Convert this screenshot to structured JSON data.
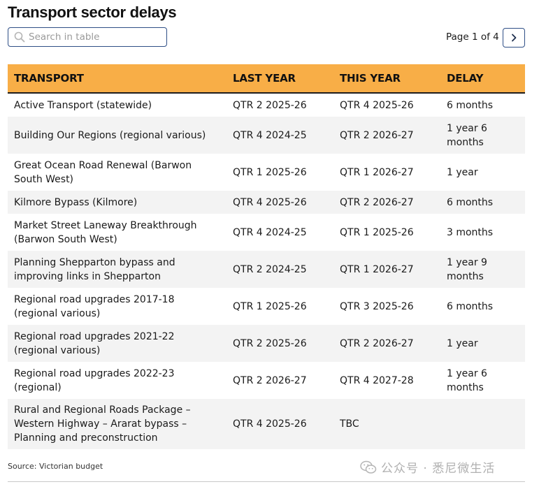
{
  "title": "Transport sector delays",
  "search": {
    "placeholder": "Search in table",
    "value": ""
  },
  "pager": {
    "text": "Page 1 of 4",
    "next_icon": "chevron-right-icon"
  },
  "table": {
    "headers": [
      "TRANSPORT",
      "LAST YEAR",
      "THIS YEAR",
      "DELAY"
    ],
    "header_color": "#f8ae47",
    "rows": [
      [
        "Active Transport (statewide)",
        "QTR 2 2025-26",
        "QTR 4 2025-26",
        "6 months"
      ],
      [
        "Building Our Regions (regional various)",
        "QTR 4 2024-25",
        "QTR 2 2026-27",
        "1 year 6\nmonths"
      ],
      [
        "Great Ocean Road Renewal (Barwon\nSouth West)",
        "QTR 1 2025-26",
        "QTR 1 2026-27",
        "1 year"
      ],
      [
        "Kilmore Bypass (Kilmore)",
        "QTR 4 2025-26",
        "QTR 2 2026-27",
        "6 months"
      ],
      [
        "Market Street Laneway Breakthrough\n(Barwon South West)",
        "QTR 4 2024-25",
        "QTR 1 2025-26",
        "3 months"
      ],
      [
        "Planning Shepparton bypass and\nimproving links in Shepparton",
        "QTR 2 2024-25",
        "QTR 1 2026-27",
        "1 year 9\nmonths"
      ],
      [
        "Regional road upgrades 2017-18\n(regional various)",
        "QTR 1 2025-26",
        "QTR 3 2025-26",
        "6 months"
      ],
      [
        "Regional road upgrades 2021-22\n(regional various)",
        "QTR 2 2025-26",
        "QTR 2 2026-27",
        "1 year"
      ],
      [
        "Regional road upgrades 2022-23\n(regional)",
        "QTR 2 2026-27",
        "QTR 4 2027-28",
        "1 year 6\nmonths"
      ],
      [
        "Rural and Regional Roads Package –\nWestern Highway – Ararat bypass –\nPlanning and preconstruction",
        "QTR 4 2025-26",
        "TBC",
        ""
      ]
    ]
  },
  "source": "Source: Victorian budget",
  "watermark": {
    "icon": "wechat-icon",
    "text": "公众号 · 悉尼微生活"
  }
}
